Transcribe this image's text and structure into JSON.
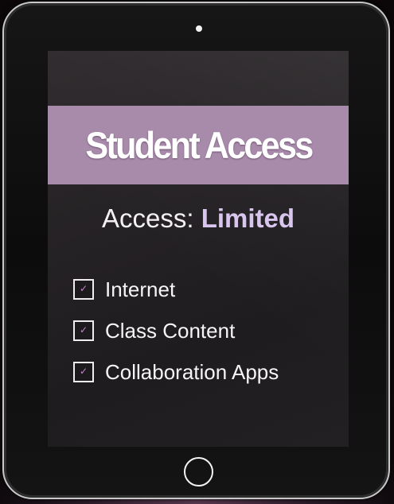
{
  "banner": {
    "title": "Student Access"
  },
  "access": {
    "label": "Access:",
    "value": "Limited"
  },
  "permissions": [
    {
      "label": "Internet",
      "checked": true,
      "icon": "check-icon"
    },
    {
      "label": "Class Content",
      "checked": true,
      "icon": "check-icon"
    },
    {
      "label": "Collaboration Apps",
      "checked": true,
      "icon": "check-icon"
    }
  ],
  "check_glyph": "✓",
  "colors": {
    "banner": "#a88aaa",
    "accent": "#d9c6ee",
    "check": "#c08ad0"
  }
}
